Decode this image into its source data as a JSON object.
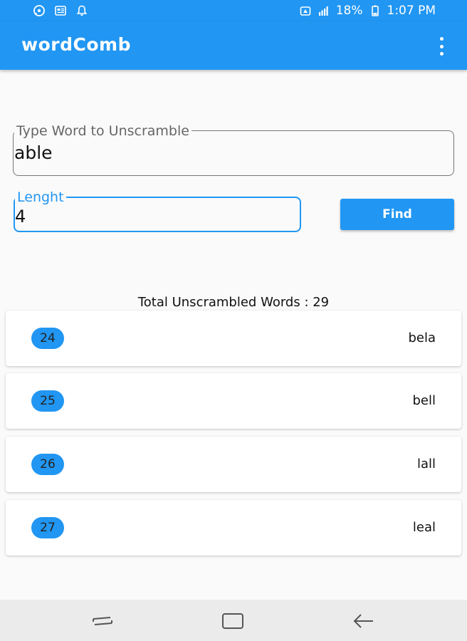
{
  "status_bar": {
    "battery_percent": "18%",
    "time": "1:07 PM",
    "left_icons": [
      "whatsapp-icon",
      "news-icon",
      "notification-bell-icon"
    ],
    "right_icons": [
      "alarm-icon",
      "signal-icon",
      "battery-icon"
    ]
  },
  "app_bar": {
    "title": "wordComb",
    "menu_icon": "more-vert-icon"
  },
  "word_field": {
    "label": "Type Word to Unscramble",
    "value": "able"
  },
  "length_field": {
    "label": "Lenght",
    "value": "4"
  },
  "find_button": {
    "label": "Find"
  },
  "total": {
    "text": "Total Unscrambled Words : 29"
  },
  "results": [
    {
      "index": "24",
      "word": "bela"
    },
    {
      "index": "25",
      "word": "bell"
    },
    {
      "index": "26",
      "word": "lall"
    },
    {
      "index": "27",
      "word": "leal"
    }
  ],
  "nav_bar": {
    "icons": [
      "recent-apps-icon",
      "home-icon",
      "back-icon"
    ]
  },
  "colors": {
    "primary": "#2196f3",
    "background": "#fafafa",
    "nav_bar": "#ebebeb"
  }
}
